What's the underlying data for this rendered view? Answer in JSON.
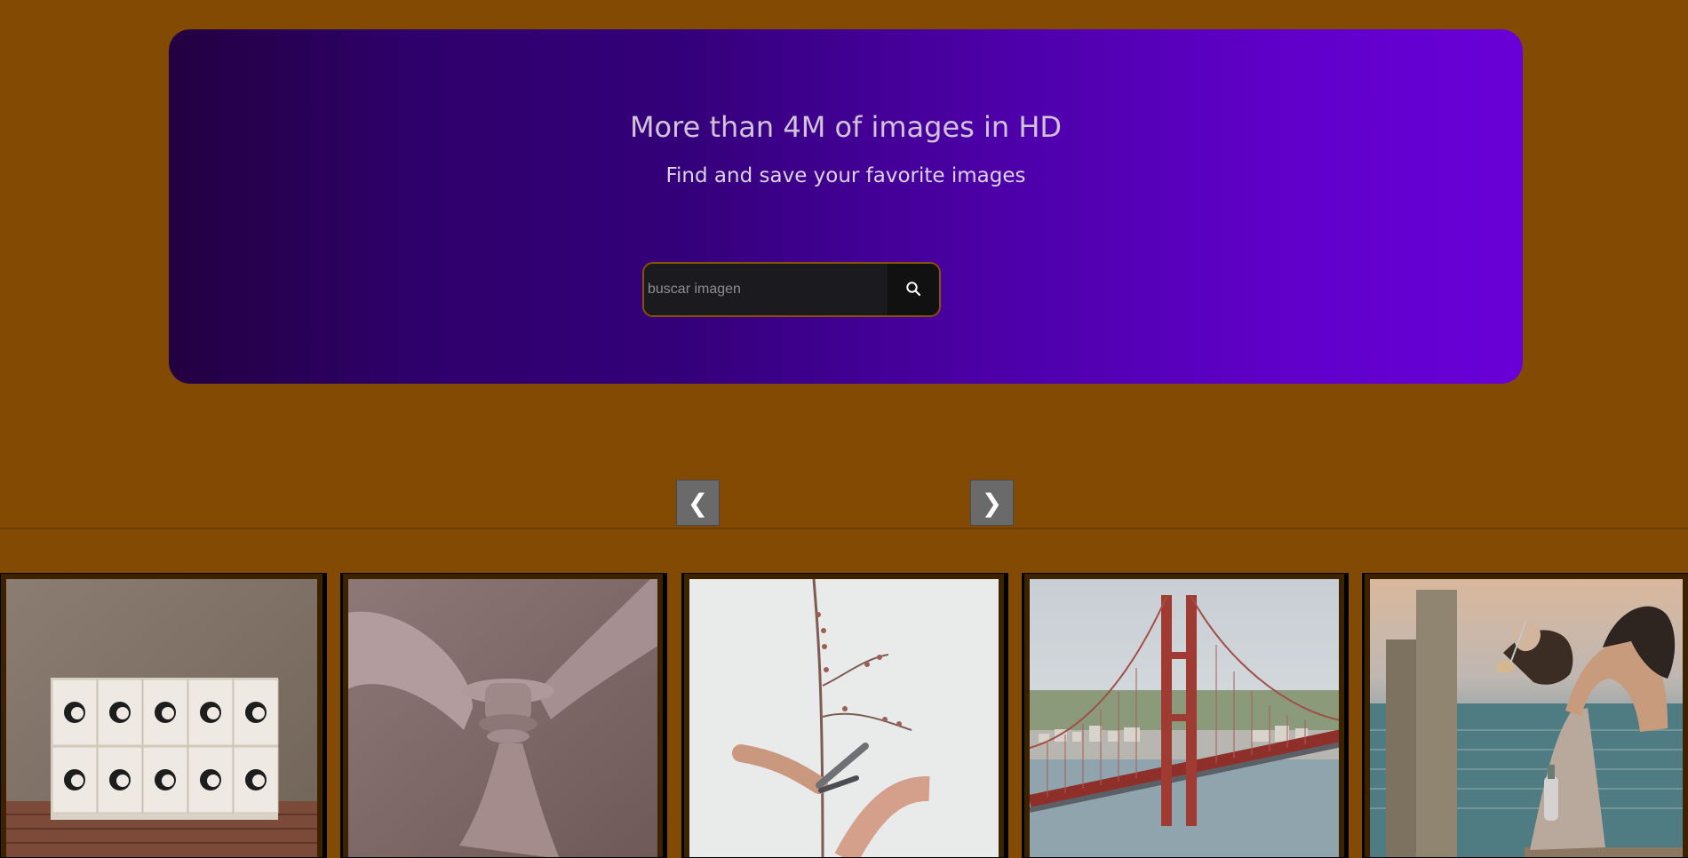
{
  "hero": {
    "title": "More than 4M of images in HD",
    "subtitle": "Find and save your favorite images"
  },
  "search": {
    "placeholder": "buscar imagen",
    "icon": "search-icon"
  },
  "carousel": {
    "prev_label": "❮",
    "next_label": "❯"
  },
  "gallery": {
    "images": [
      {
        "subject": "posters on wall"
      },
      {
        "subject": "ceiling fan"
      },
      {
        "subject": "pruning branch"
      },
      {
        "subject": "bridge over river"
      },
      {
        "subject": "people on pier"
      }
    ]
  },
  "colors": {
    "page_background": "#824a02",
    "hero_gradient_start": "#230040",
    "hero_gradient_end": "#6900d8",
    "search_border": "#8a5200",
    "button_dark": "#111112",
    "nav_button": "#6a6a6a"
  }
}
